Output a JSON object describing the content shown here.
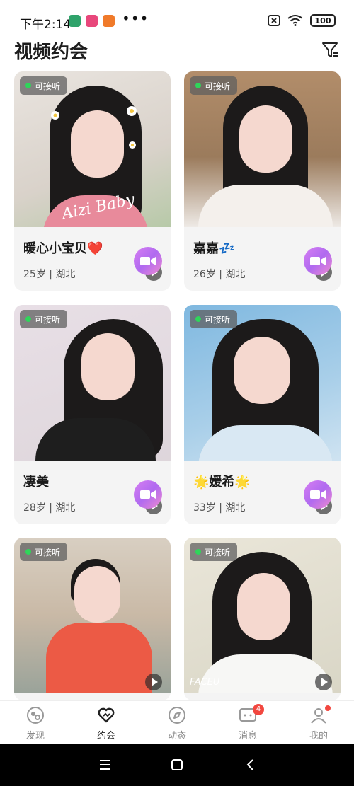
{
  "status_bar": {
    "time": "下午2:14",
    "battery": "100",
    "dots": "•••"
  },
  "header": {
    "title": "视频约会",
    "filter_icon": "filter-icon"
  },
  "cards": [
    {
      "name": "暖心小宝贝❤️",
      "info": "25岁 | 湖北",
      "badge": "可接听"
    },
    {
      "name": "嘉嘉💤",
      "info": "26岁 | 湖北",
      "badge": "可接听"
    },
    {
      "name": "凄美",
      "info": "28岁 | 湖北",
      "badge": "可接听"
    },
    {
      "name": "🌟媛希🌟",
      "info": "33岁 | 湖北",
      "badge": "可接听"
    },
    {
      "name": "",
      "info": "",
      "badge": "可接听"
    },
    {
      "name": "",
      "info": "",
      "badge": "可接听"
    }
  ],
  "photo_texts": {
    "signature": "Aizi Baby",
    "watermark": "FACEU"
  },
  "bottom_nav": {
    "items": [
      {
        "label": "发现",
        "icon": "discover-icon"
      },
      {
        "label": "约会",
        "icon": "heart-icon",
        "active": true
      },
      {
        "label": "动态",
        "icon": "compass-icon"
      },
      {
        "label": "消息",
        "icon": "message-icon",
        "badge": "4"
      },
      {
        "label": "我的",
        "icon": "profile-icon"
      }
    ]
  },
  "colors": {
    "accent_gradient_start": "#d77ef2",
    "accent_gradient_end": "#f08ad0",
    "online_dot": "#2fd55a",
    "badge_red": "#f2473f"
  }
}
